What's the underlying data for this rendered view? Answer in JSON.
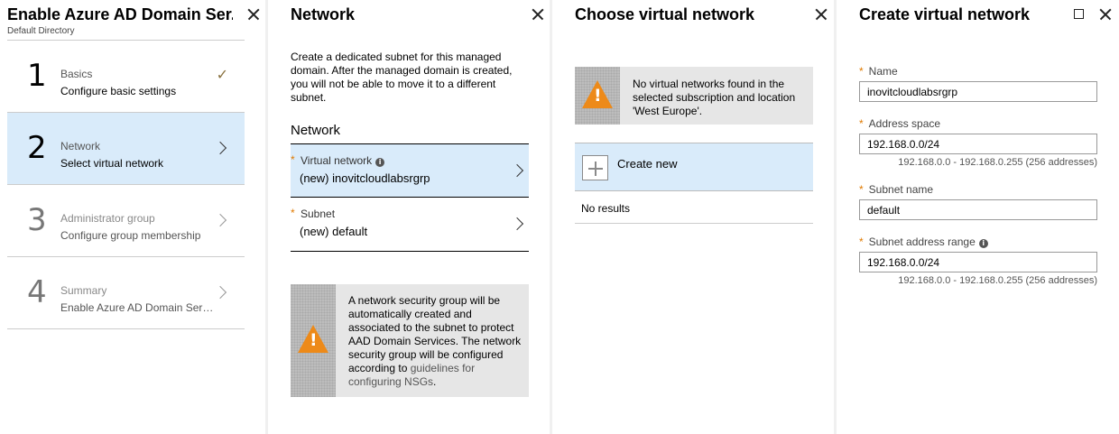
{
  "blade1": {
    "title": "Enable Azure AD Domain Ser...",
    "subtitle": "Default Directory",
    "steps": [
      {
        "number": "1",
        "title": "Basics",
        "desc": "Configure basic settings",
        "state": "completed"
      },
      {
        "number": "2",
        "title": "Network",
        "desc": "Select virtual network",
        "state": "selected"
      },
      {
        "number": "3",
        "title": "Administrator group",
        "desc": "Configure group membership",
        "state": "disabled"
      },
      {
        "number": "4",
        "title": "Summary",
        "desc": "Enable Azure AD Domain Servi...",
        "state": "disabled"
      }
    ],
    "check_glyph": "✓"
  },
  "blade2": {
    "title": "Network",
    "intro": "Create a dedicated subnet for this managed domain. After the managed domain is created, you will not be able to move it to a different subnet.",
    "section_heading": "Network",
    "virtual_network": {
      "label": "Virtual network",
      "value": "(new) inovitcloudlabsrgrp"
    },
    "subnet": {
      "label": "Subnet",
      "value": "(new) default"
    },
    "warning": {
      "text": "A network security group will be automatically created and associated to the subnet to protect AAD Domain Services. The network security group will be configured according to ",
      "link": "guidelines for configuring NSGs",
      "suffix": "."
    }
  },
  "blade3": {
    "title": "Choose virtual network",
    "warning": "No virtual networks found in the selected subscription and location 'West Europe'.",
    "create_new": "Create new",
    "no_results": "No results"
  },
  "blade4": {
    "title": "Create virtual network",
    "name": {
      "label": "Name",
      "value": "inovitcloudlabsrgrp"
    },
    "address_space": {
      "label": "Address space",
      "value": "192.168.0.0/24",
      "hint": "192.168.0.0 - 192.168.0.255 (256 addresses)"
    },
    "subnet_name": {
      "label": "Subnet name",
      "value": "default"
    },
    "subnet_range": {
      "label": "Subnet address range",
      "value": "192.168.0.0/24",
      "hint": "192.168.0.0 - 192.168.0.255 (256 addresses)"
    }
  },
  "glyphs": {
    "required": "*",
    "info": "i",
    "warning": "!"
  },
  "colors": {
    "selected_bg": "#d9ebfa",
    "warning_orange": "#ed8a19",
    "required_star": "#e07a00"
  }
}
